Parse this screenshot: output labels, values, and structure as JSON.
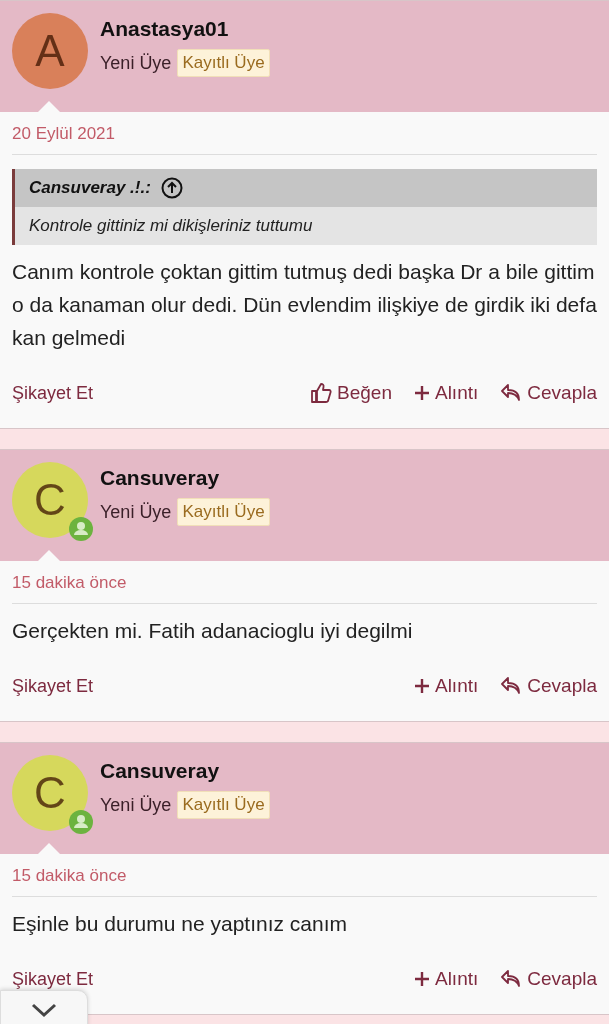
{
  "posts": [
    {
      "author": "Anastasya01",
      "avatar": {
        "letter": "A",
        "color": "#d9805a"
      },
      "online": false,
      "rank": "Yeni Üye",
      "badge": "Kayıtlı Üye",
      "date": "20 Eylül 2021",
      "quote": {
        "author": "Cansuveray .!.:",
        "text": "Kontrole gittiniz mi dikişleriniz tuttumu"
      },
      "text": "Canım kontrole çoktan gittim tutmuş dedi başka Dr a bile gittim o da kanaman olur dedi. Dün evlendim ilişkiye de girdik iki defa kan gelmedi",
      "actions": {
        "report": "Şikayet Et",
        "like": "Beğen",
        "quote": "Alıntı",
        "reply": "Cevapla"
      }
    },
    {
      "author": "Cansuveray",
      "avatar": {
        "letter": "C",
        "color": "#d6d85c"
      },
      "online": true,
      "rank": "Yeni Üye",
      "badge": "Kayıtlı Üye",
      "date": "15 dakika önce",
      "text": "Gerçekten mi. Fatih adanacioglu iyi degilmi",
      "actions": {
        "report": "Şikayet Et",
        "quote": "Alıntı",
        "reply": "Cevapla"
      }
    },
    {
      "author": "Cansuveray",
      "avatar": {
        "letter": "C",
        "color": "#d6d85c"
      },
      "online": true,
      "rank": "Yeni Üye",
      "badge": "Kayıtlı Üye",
      "date": "15 dakika önce",
      "text": "Eşinle bu durumu ne yaptınız canım",
      "actions": {
        "report": "Şikayet Et",
        "quote": "Alıntı",
        "reply": "Cevapla"
      }
    }
  ]
}
